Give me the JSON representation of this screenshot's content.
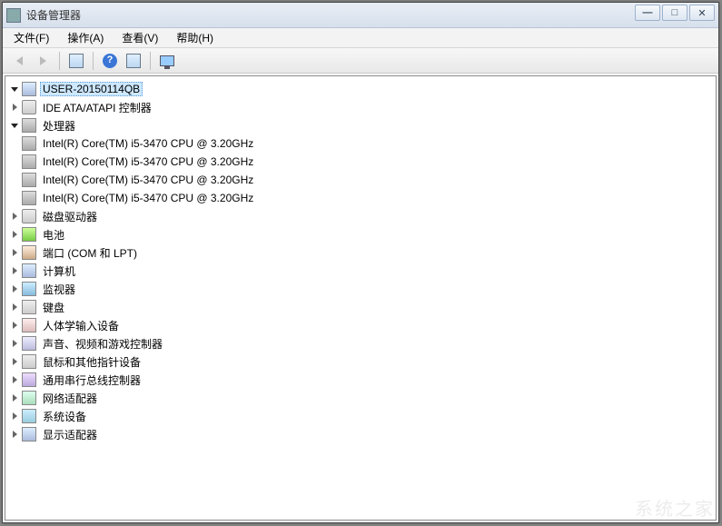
{
  "title": "设备管理器",
  "menu": {
    "file": "文件(F)",
    "action": "操作(A)",
    "view": "查看(V)",
    "help": "帮助(H)"
  },
  "tree": {
    "root": "USER-20150114QB",
    "categories": [
      {
        "label": "IDE ATA/ATAPI 控制器",
        "iconClass": "disk"
      },
      {
        "label": "处理器",
        "iconClass": "cpu",
        "expanded": true,
        "children": [
          "Intel(R) Core(TM) i5-3470 CPU @ 3.20GHz",
          "Intel(R) Core(TM) i5-3470 CPU @ 3.20GHz",
          "Intel(R) Core(TM) i5-3470 CPU @ 3.20GHz",
          "Intel(R) Core(TM) i5-3470 CPU @ 3.20GHz"
        ]
      },
      {
        "label": "磁盘驱动器",
        "iconClass": "disk"
      },
      {
        "label": "电池",
        "iconClass": "battery"
      },
      {
        "label": "端口 (COM 和 LPT)",
        "iconClass": "port"
      },
      {
        "label": "计算机",
        "iconClass": "computer"
      },
      {
        "label": "监视器",
        "iconClass": "monitor"
      },
      {
        "label": "键盘",
        "iconClass": "keyboard"
      },
      {
        "label": "人体学输入设备",
        "iconClass": "hid"
      },
      {
        "label": "声音、视频和游戏控制器",
        "iconClass": "sound"
      },
      {
        "label": "鼠标和其他指针设备",
        "iconClass": "mouse"
      },
      {
        "label": "通用串行总线控制器",
        "iconClass": "usb"
      },
      {
        "label": "网络适配器",
        "iconClass": "network"
      },
      {
        "label": "系统设备",
        "iconClass": "system"
      },
      {
        "label": "显示适配器",
        "iconClass": "display"
      }
    ]
  },
  "watermark": "系统之家"
}
